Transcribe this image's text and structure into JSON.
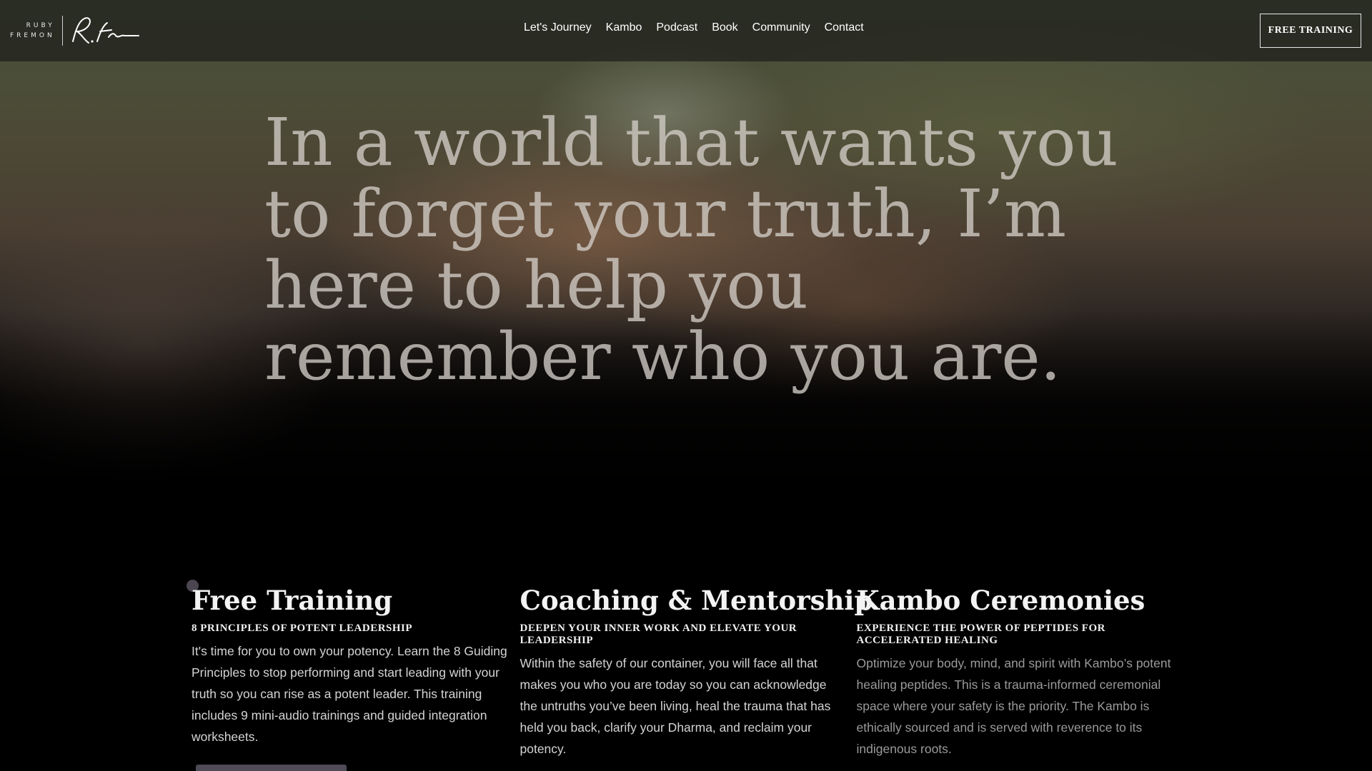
{
  "logo": {
    "line1": "RUBY",
    "line2": "FREMON",
    "signature": "R.Fr"
  },
  "nav": {
    "items": [
      "Let's Journey",
      "Kambo",
      "Podcast",
      "Book",
      "Community",
      "Contact"
    ],
    "cta_label": "FREE TRAINING"
  },
  "hero": {
    "headline": "In a world that wants you to forget your truth, I’m here to help you remember who you are."
  },
  "features": [
    {
      "title": "Free Training",
      "subtitle": "8 PRINCIPLES OF POTENT LEADERSHIP",
      "body": "It's time for you to own your potency. Learn the 8 Guiding Principles to stop performing and start leading with your truth so you can rise as a potent leader. This training includes 9 mini-audio trainings and guided integration worksheets."
    },
    {
      "title": "Coaching & Mentorship",
      "subtitle": "DEEPEN YOUR INNER WORK AND ELEVATE YOUR LEADERSHIP",
      "body": "Within the safety of our container, you will face all that makes you who you are today so you can acknowledge the untruths you’ve been living, heal the trauma that has held you back, clarify your Dharma, and reclaim your potency."
    },
    {
      "title": "Kambo Ceremonies",
      "subtitle": "EXPERIENCE THE POWER OF PEPTIDES FOR ACCELERATED HEALING",
      "body": "Optimize your body, mind, and spirit with Kambo’s potent healing peptides. This is a trauma-informed ceremonial space where your safety is the priority. The Kambo is ethically sourced and is served with reverence to its indigenous roots."
    }
  ],
  "colors": {
    "background": "#000000",
    "accent_button": "#4e4a57"
  }
}
